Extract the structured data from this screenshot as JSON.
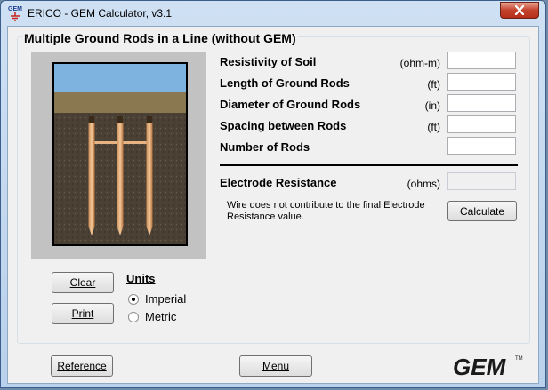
{
  "window": {
    "title": "ERICO - GEM Calculator, v3.1",
    "icon_label": "GEM"
  },
  "group": {
    "title": "Multiple Ground Rods in a Line (without GEM)"
  },
  "fields": [
    {
      "label": "Resistivity of Soil",
      "unit": "(ohm-m)",
      "value": ""
    },
    {
      "label": "Length of Ground Rods",
      "unit": "(ft)",
      "value": ""
    },
    {
      "label": "Diameter of Ground Rods",
      "unit": "(in)",
      "value": ""
    },
    {
      "label": "Spacing between Rods",
      "unit": "(ft)",
      "value": ""
    },
    {
      "label": "Number of Rods",
      "unit": "",
      "value": ""
    }
  ],
  "result": {
    "label": "Electrode Resistance",
    "unit": "(ohms)",
    "value": ""
  },
  "note": "Wire does not contribute to the final Electrode Resistance value.",
  "buttons": {
    "calculate": "Calculate",
    "clear": "Clear",
    "print": "Print",
    "reference": "Reference",
    "menu": "Menu"
  },
  "units": {
    "title": "Units",
    "options": [
      {
        "label": "Imperial",
        "selected": true
      },
      {
        "label": "Metric",
        "selected": false
      }
    ]
  },
  "logo": {
    "text": "GEM",
    "mark": "TM"
  },
  "icons": {
    "close": "close-icon",
    "app": "gem-app-icon"
  }
}
